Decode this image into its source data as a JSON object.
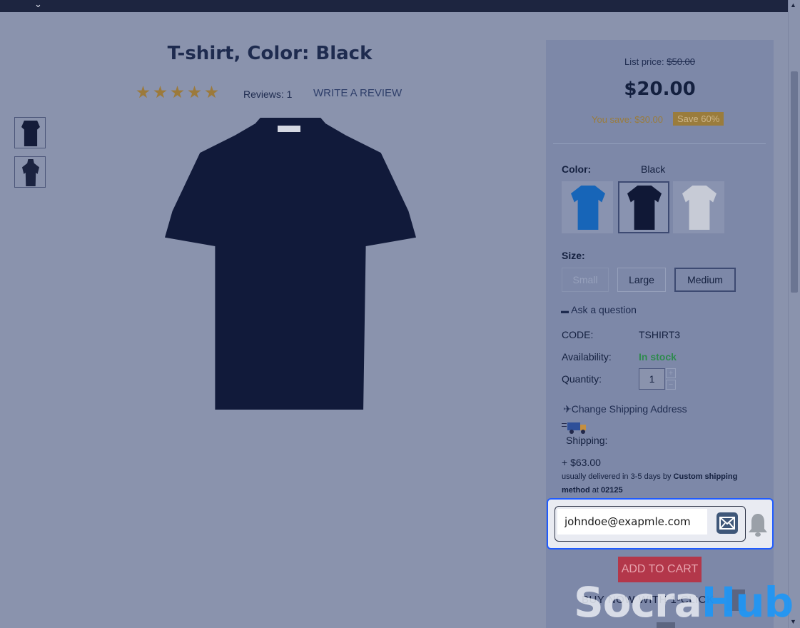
{
  "product": {
    "title": "T-shirt, Color: Black",
    "rating_stars": 5,
    "reviews_label": "Reviews: 1",
    "write_review": "WRITE A REVIEW"
  },
  "pricing": {
    "list_price_label": "List price:",
    "list_price": "$50.00",
    "price": "$20.00",
    "you_save": "You save: $30.00",
    "save_badge": "Save 60%"
  },
  "color": {
    "label": "Color:",
    "selected": "Black",
    "swatches": [
      {
        "name": "Blue",
        "hex": "#1765b8"
      },
      {
        "name": "Black",
        "hex": "#101836"
      },
      {
        "name": "White",
        "hex": "#c7cbd6"
      }
    ]
  },
  "size": {
    "label": "Size:",
    "options": [
      "Small",
      "Large",
      "Medium"
    ]
  },
  "ask_question": "Ask a question",
  "details": {
    "code_label": "CODE:",
    "code": "TSHIRT3",
    "availability_label": "Availability:",
    "availability": "In stock",
    "quantity_label": "Quantity:",
    "quantity": "1"
  },
  "shipping": {
    "change_address": "Change Shipping Address",
    "label": "Shipping:",
    "cost": "+ $63.00",
    "delivery_prefix": "usually delivered in 3-5 days by",
    "method": "Custom shipping method",
    "at": "at",
    "zip": "02125"
  },
  "notify": {
    "email_value": "johndoe@exapmle.com"
  },
  "actions": {
    "add_to_cart": "ADD TO CART",
    "buy_now": "BUY NOW WITH 1-CLICK"
  },
  "watermark": {
    "part1": "Socra",
    "part2": "Hub"
  },
  "colors": {
    "overlay": "#8a93ad",
    "price_save": "#9a7c3c",
    "in_stock": "#2e8a4e",
    "add_to_cart": "#b3374a",
    "focus_border": "#1f5bff"
  }
}
